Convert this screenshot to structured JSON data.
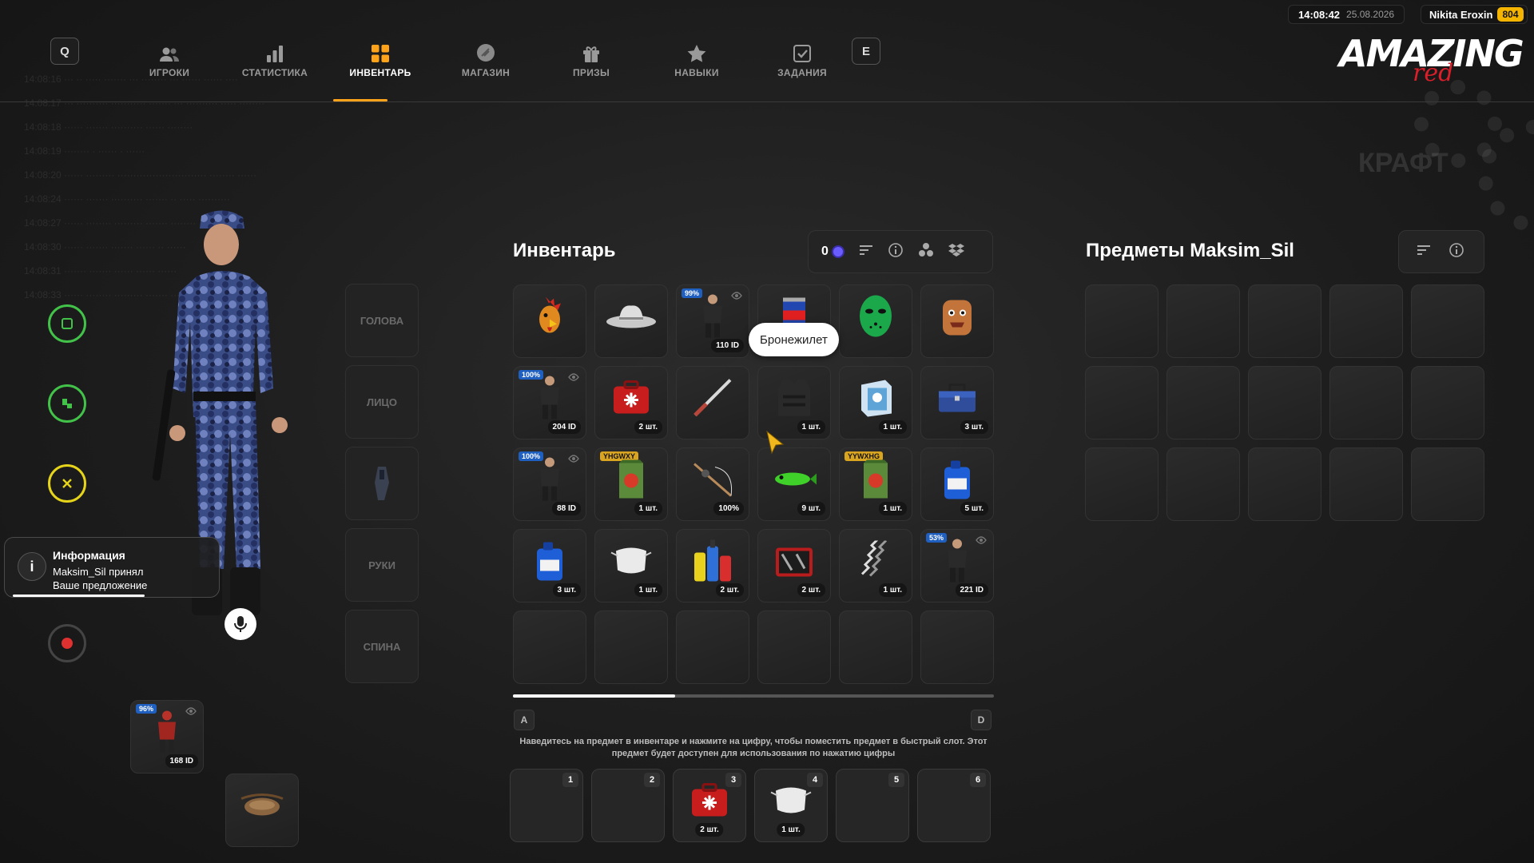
{
  "header": {
    "left_key": "Q",
    "right_key": "E",
    "tabs": [
      {
        "label": "ИГРОКИ",
        "icon": "players-icon"
      },
      {
        "label": "СТАТИСТИКА",
        "icon": "bar-chart-icon"
      },
      {
        "label": "ИНВЕНТАРЬ",
        "icon": "grid-icon",
        "active": true
      },
      {
        "label": "МАГАЗИН",
        "icon": "shop-icon"
      },
      {
        "label": "ПРИЗЫ",
        "icon": "gift-icon"
      },
      {
        "label": "НАВЫКИ",
        "icon": "star-icon"
      },
      {
        "label": "ЗАДАНИЯ",
        "icon": "checkbox-icon"
      }
    ],
    "time": "14:08:42",
    "date": "25.08.2026",
    "user_name": "Nikita Eroxin",
    "user_id": "804",
    "logo_main": "AMAZING",
    "logo_sub": "red",
    "accent": "#ffa31a"
  },
  "background": {
    "craft": "КРАФТ"
  },
  "notification": {
    "title": "Информация",
    "text": "Maksim_Sil принял Ваше предложение"
  },
  "body_slots": [
    "ГОЛОВА",
    "ЛИЦО",
    "",
    "РУКИ",
    "СПИНА"
  ],
  "equipment": [
    {
      "pct": "96%",
      "qty": "168 ID",
      "icon": "skin-icon"
    },
    {
      "pct": "",
      "qty": "",
      "icon": "belt-bag-icon"
    }
  ],
  "inventory": {
    "title": "Инвентарь",
    "currency": "0",
    "tooltip": "Бронежилет",
    "items": [
      {
        "icon": "rooster-mask-icon",
        "qty": "",
        "badge": ""
      },
      {
        "icon": "cowboy-hat-icon",
        "qty": "",
        "badge": ""
      },
      {
        "icon": "skin-icon",
        "qty": "110 ID",
        "badge": "99%",
        "eye": true
      },
      {
        "icon": "energy-drink-icon",
        "qty": "",
        "badge": ""
      },
      {
        "icon": "hockey-mask-icon",
        "qty": "",
        "badge": ""
      },
      {
        "icon": "backpack-icon",
        "qty": "",
        "badge": ""
      },
      {
        "icon": "skin-icon",
        "qty": "204 ID",
        "badge": "100%",
        "eye": true
      },
      {
        "icon": "medkit-icon",
        "qty": "2 шт.",
        "badge": ""
      },
      {
        "icon": "katana-icon",
        "qty": "",
        "badge": ""
      },
      {
        "icon": "vest-icon",
        "qty": "1 шт.",
        "badge": ""
      },
      {
        "icon": "box-icon",
        "qty": "1 шт.",
        "badge": ""
      },
      {
        "icon": "toolbox-icon",
        "qty": "3 шт.",
        "badge": ""
      },
      {
        "icon": "skin-icon",
        "qty": "88 ID",
        "badge": "100%",
        "eye": true
      },
      {
        "icon": "seed-bag-icon",
        "qty": "1 шт.",
        "code": "YHGWXY"
      },
      {
        "icon": "fishing-rod-icon",
        "qty": "100%",
        "badge": ""
      },
      {
        "icon": "fishing-lure-icon",
        "qty": "9 шт.",
        "badge": ""
      },
      {
        "icon": "seed-bag-icon",
        "qty": "1 шт.",
        "code": "YYWXHG"
      },
      {
        "icon": "canister-icon",
        "qty": "5 шт.",
        "badge": ""
      },
      {
        "icon": "canister-icon",
        "qty": "3 шт.",
        "badge": ""
      },
      {
        "icon": "face-mask-icon",
        "qty": "1 шт.",
        "badge": ""
      },
      {
        "icon": "cleaners-icon",
        "qty": "2 шт.",
        "badge": ""
      },
      {
        "icon": "tool-case-icon",
        "qty": "2 шт.",
        "badge": ""
      },
      {
        "icon": "spring-icon",
        "qty": "1 шт.",
        "badge": ""
      },
      {
        "icon": "skin-icon",
        "qty": "221 ID",
        "badge": "53%",
        "eye": true
      },
      {
        "icon": "",
        "qty": "",
        "badge": ""
      },
      {
        "icon": "",
        "qty": "",
        "badge": ""
      },
      {
        "icon": "",
        "qty": "",
        "badge": ""
      },
      {
        "icon": "",
        "qty": "",
        "badge": ""
      },
      {
        "icon": "",
        "qty": "",
        "badge": ""
      },
      {
        "icon": "",
        "qty": "",
        "badge": ""
      }
    ],
    "scroll_left_key": "A",
    "scroll_right_key": "D",
    "hint": "Наведитесь на предмет в инвентаре и нажмите на цифру, чтобы поместить предмет в быстрый слот. Этот предмет будет доступен для использования по нажатию цифры",
    "quick_slots": [
      {
        "num": "1",
        "icon": "",
        "qty": ""
      },
      {
        "num": "2",
        "icon": "",
        "qty": ""
      },
      {
        "num": "3",
        "icon": "medkit-icon",
        "qty": "2 шт."
      },
      {
        "num": "4",
        "icon": "face-mask-icon",
        "qty": "1 шт."
      },
      {
        "num": "5",
        "icon": "",
        "qty": ""
      },
      {
        "num": "6",
        "icon": "",
        "qty": ""
      }
    ]
  },
  "trade": {
    "title": "Предметы Maksim_Sil",
    "slots": 15
  }
}
